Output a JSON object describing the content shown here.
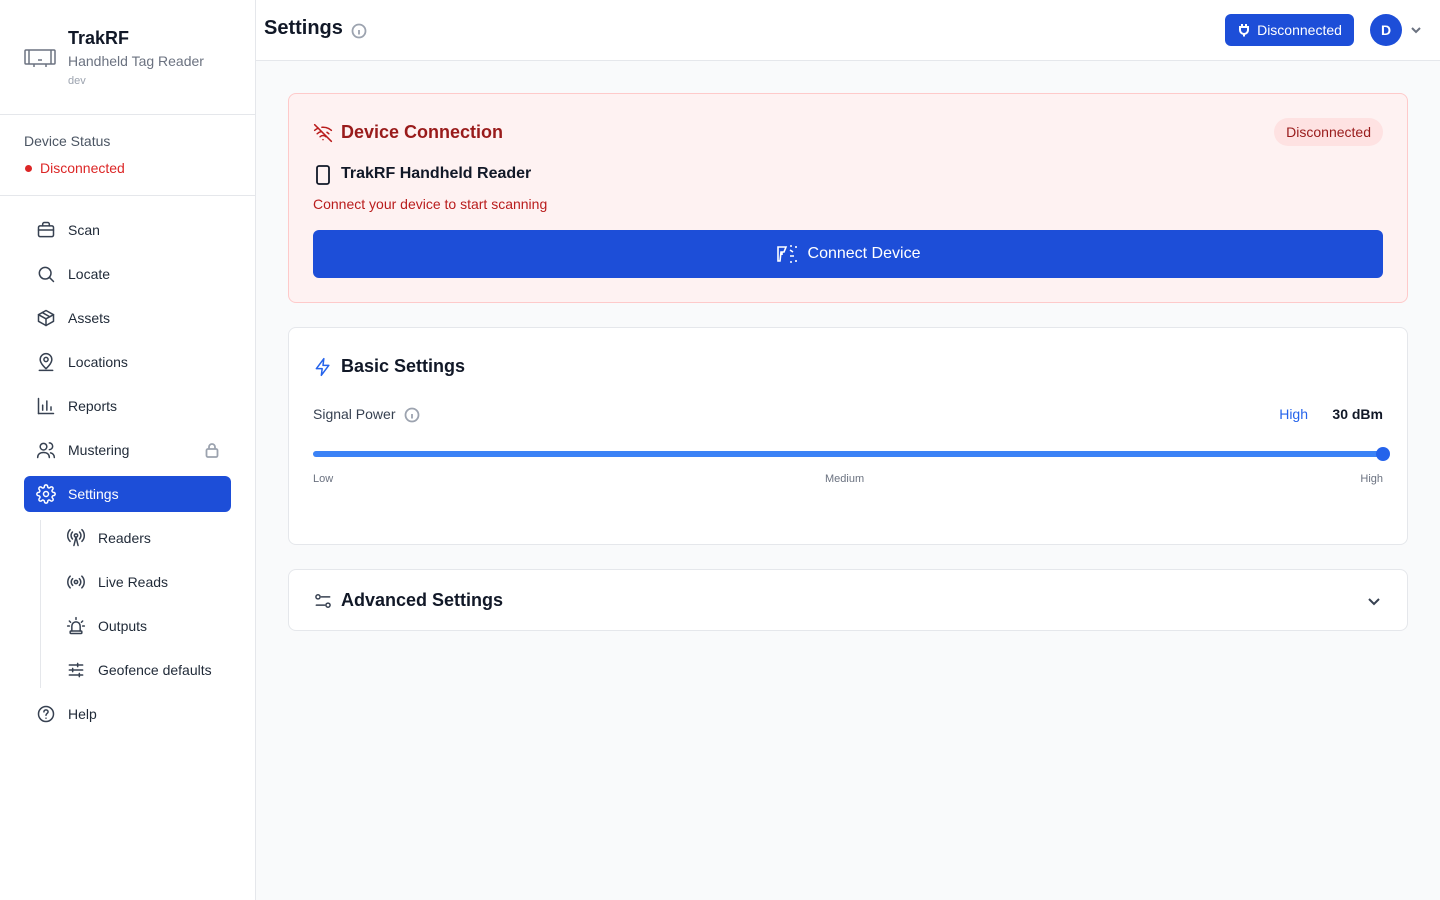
{
  "brand": {
    "name": "TrakRF",
    "subtitle": "Handheld Tag Reader",
    "env": "dev"
  },
  "device_status": {
    "title": "Device Status",
    "value": "Disconnected"
  },
  "nav": {
    "items": [
      {
        "label": "Scan"
      },
      {
        "label": "Locate"
      },
      {
        "label": "Assets"
      },
      {
        "label": "Locations"
      },
      {
        "label": "Reports"
      },
      {
        "label": "Mustering"
      },
      {
        "label": "Settings"
      }
    ],
    "sub_items": [
      {
        "label": "Readers"
      },
      {
        "label": "Live Reads"
      },
      {
        "label": "Outputs"
      },
      {
        "label": "Geofence defaults"
      }
    ],
    "help": "Help"
  },
  "header": {
    "title": "Settings",
    "connection_button": "Disconnected",
    "avatar_initial": "D"
  },
  "device_connection": {
    "title": "Device Connection",
    "badge": "Disconnected",
    "device_name": "TrakRF Handheld Reader",
    "message": "Connect your device to start scanning",
    "connect_button": "Connect Device"
  },
  "basic_settings": {
    "title": "Basic Settings",
    "signal_power": {
      "label": "Signal Power",
      "level": "High",
      "value": "30 dBm",
      "fraction": 1.0,
      "ticks": [
        "Low",
        "Medium",
        "High"
      ]
    }
  },
  "advanced_settings": {
    "title": "Advanced Settings"
  },
  "colors": {
    "primary": "#1d4ed8",
    "danger": "#dc2626",
    "danger_bg": "#fef2f2"
  }
}
